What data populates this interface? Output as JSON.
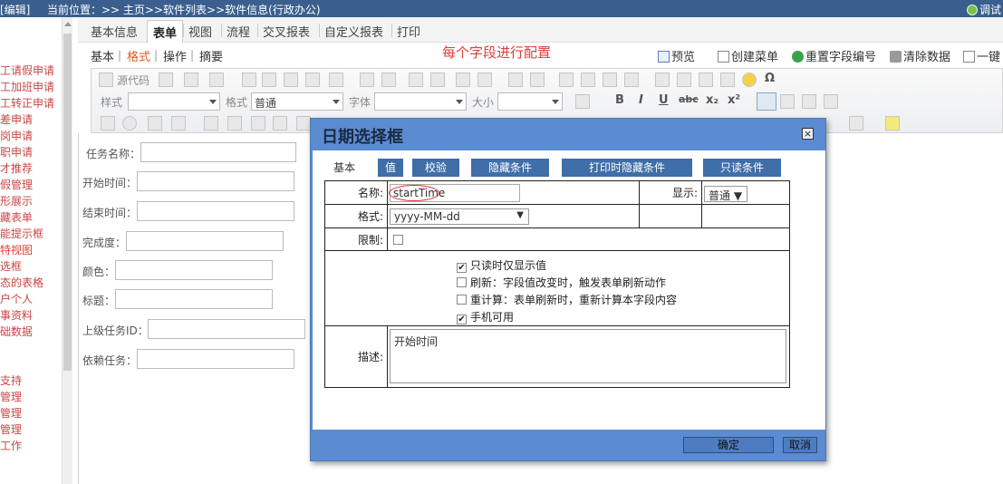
{
  "topbar": {
    "edit_label": "[编辑]",
    "location": "当前位置：>> 主页>>软件列表>>软件信息(行政办公)",
    "debug_label": "调试"
  },
  "sidebar": {
    "items": [
      {
        "label": "工请假申请",
        "active": false,
        "gray": false
      },
      {
        "label": "工加班申请",
        "active": false,
        "gray": false
      },
      {
        "label": "工转正申请",
        "active": false,
        "gray": false
      },
      {
        "label": "差申请",
        "active": false,
        "gray": false
      },
      {
        "label": "岗申请",
        "active": false,
        "gray": false
      },
      {
        "label": "职申请",
        "active": false,
        "gray": false
      },
      {
        "label": "才推荐",
        "active": false,
        "gray": false
      },
      {
        "label": "假管理",
        "active": false,
        "gray": false
      },
      {
        "label": "形展示",
        "active": false,
        "gray": false
      },
      {
        "label": "藏表单",
        "active": false,
        "gray": false
      },
      {
        "label": "能提示框",
        "active": false,
        "gray": false
      },
      {
        "label": "特视图",
        "active": true,
        "gray": false
      },
      {
        "label": "选框",
        "active": false,
        "gray": false
      },
      {
        "label": "态的表格",
        "active": false,
        "gray": false
      },
      {
        "label": "户个人",
        "active": false,
        "gray": false
      },
      {
        "label": "事资料",
        "active": false,
        "gray": false
      },
      {
        "label": "础数据",
        "active": false,
        "gray": false
      },
      {
        "label": "支持",
        "active": false,
        "gray": false
      },
      {
        "label": "管理",
        "active": false,
        "gray": false
      },
      {
        "label": "管理",
        "active": false,
        "gray": false
      },
      {
        "label": "管理",
        "active": false,
        "gray": false
      },
      {
        "label": "工作",
        "active": false,
        "gray": false
      }
    ]
  },
  "tabs": [
    "基本信息",
    "表单",
    "视图",
    "流程",
    "交叉报表",
    "自定义报表",
    "打印"
  ],
  "active_tab": "表单",
  "subtabs": [
    "基本",
    "格式",
    "操作",
    "摘要"
  ],
  "active_subtab": "格式",
  "hint": "每个字段进行配置",
  "actions": {
    "preview": "预览",
    "create_menu": "创建菜单",
    "reset_field_no": "重置字段编号",
    "clear_data": "清除数据",
    "one_key": "一键"
  },
  "editor": {
    "source_label": "源代码",
    "style_label": "样式",
    "format_label": "格式",
    "format_value": "普通",
    "font_label": "字体",
    "size_label": "大小",
    "bold": "B",
    "italic": "I",
    "underline": "U",
    "strike": "abc",
    "sub": "x₂",
    "sup": "x²",
    "omega": "Ω"
  },
  "form_fields": [
    {
      "label": "任务名称："
    },
    {
      "label": "开始时间："
    },
    {
      "label": "结束时间："
    },
    {
      "label": "完成度："
    },
    {
      "label": "颜色："
    },
    {
      "label": "标题："
    },
    {
      "label": "上级任务ID："
    },
    {
      "label": "依赖任务："
    }
  ],
  "dialog": {
    "title": "日期选择框",
    "close": "×",
    "tabs": [
      "基本",
      "值",
      "校验",
      "隐藏条件",
      "打印时隐藏条件",
      "只读条件"
    ],
    "name_label": "名称:",
    "name_value": "startTime",
    "show_label": "显示:",
    "show_value": "普通",
    "format_label": "格式:",
    "format_value": "yyyy-MM-dd",
    "limit_label": "限制:",
    "options": [
      {
        "label": "只读时仅显示值",
        "checked": true
      },
      {
        "label": "刷新：字段值改变时，触发表单刷新动作",
        "checked": false
      },
      {
        "label": "重计算：表单刷新时，重新计算本字段内容",
        "checked": false
      },
      {
        "label": "手机可用",
        "checked": true
      }
    ],
    "desc_label": "描述:",
    "desc_value": "开始时间",
    "ok": "确定",
    "cancel": "取消"
  },
  "colors": {
    "accent": "#3f6ea8",
    "dialog_bg": "#5b8bd1",
    "hint": "#e0403a",
    "topbar": "#3a5f8f"
  }
}
